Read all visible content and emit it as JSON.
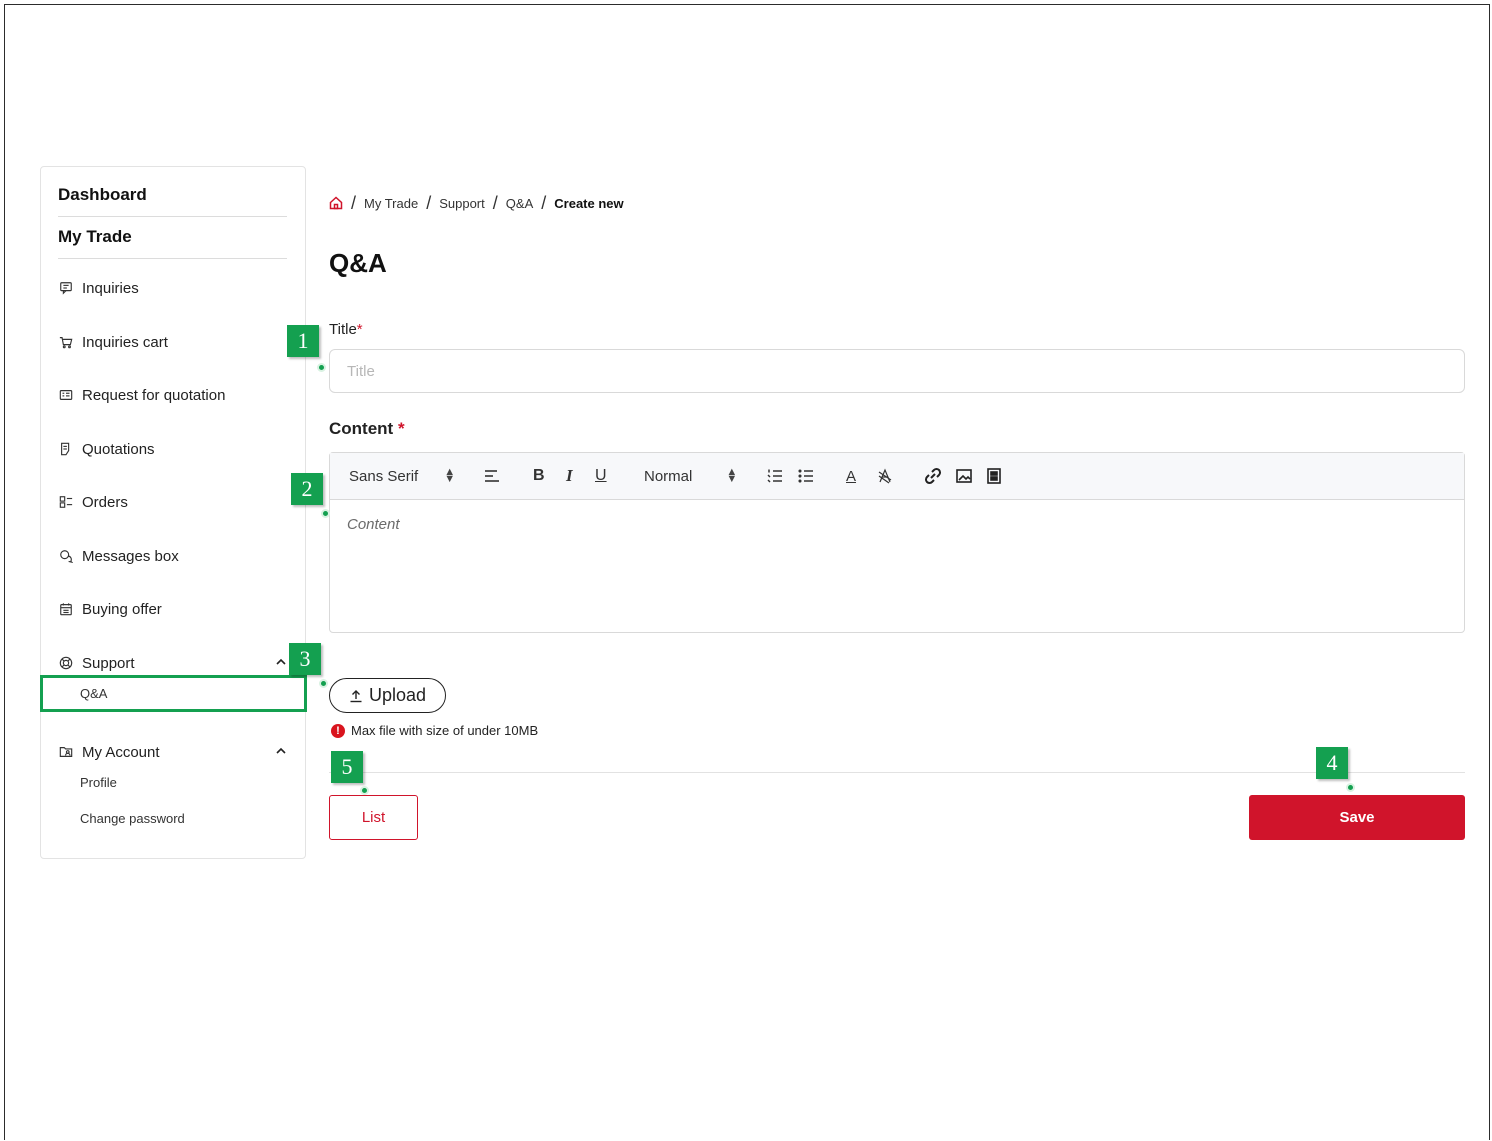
{
  "sidebar": {
    "dashboard": "Dashboard",
    "my_trade": "My Trade",
    "items": [
      {
        "label": "Inquiries",
        "icon": "message-square-icon"
      },
      {
        "label": "Inquiries cart",
        "icon": "cart-icon"
      },
      {
        "label": "Request for quotation",
        "icon": "form-icon"
      },
      {
        "label": "Quotations",
        "icon": "document-icon"
      },
      {
        "label": "Orders",
        "icon": "orders-list-icon"
      },
      {
        "label": "Messages box",
        "icon": "chat-bubbles-icon"
      },
      {
        "label": "Buying offer",
        "icon": "calendar-icon"
      }
    ],
    "support": {
      "label": "Support",
      "icon": "lifebuoy-icon",
      "sub": [
        "Q&A"
      ]
    },
    "my_account": {
      "label": "My Account",
      "icon": "account-icon",
      "sub": [
        "Profile",
        "Change password"
      ]
    }
  },
  "breadcrumb": {
    "items": [
      "My Trade",
      "Support",
      "Q&A"
    ],
    "current": "Create new",
    "separator": "/"
  },
  "page": {
    "title": "Q&A"
  },
  "form": {
    "title_label": "Title",
    "title_placeholder": "Title",
    "title_value": "",
    "content_label": "Content",
    "required_mark": "*",
    "content_placeholder": "Content",
    "toolbar": {
      "font": "Sans Serif",
      "size": "Normal",
      "bold": "B",
      "italic": "I",
      "underline": "U",
      "color": "A"
    },
    "upload_label": "Upload",
    "upload_hint": "Max file with size of under 10MB",
    "hint_icon_text": "!"
  },
  "actions": {
    "list": "List",
    "save": "Save"
  },
  "callouts": [
    "1",
    "2",
    "3",
    "4",
    "5"
  ],
  "colors": {
    "accent": "#d0142b",
    "callout": "#14a050"
  }
}
